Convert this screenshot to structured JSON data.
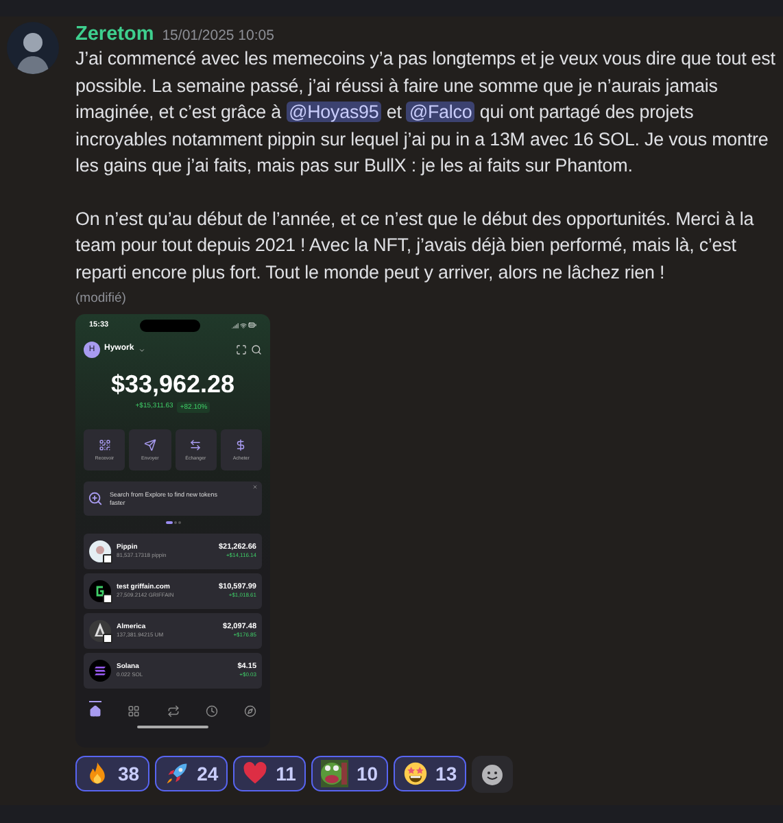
{
  "message": {
    "author": "Zeretom",
    "timestamp": "15/01/2025 10:05",
    "paragraphs": [
      [
        {
          "kind": "text",
          "text": "J’ai commencé avec les memecoins y’a pas longtemps et je veux vous dire que tout est possible. La semaine passé, j’ai réussi à faire une somme que je n’aurais jamais imaginée, et c’est grâce à "
        },
        {
          "kind": "mention",
          "text": "@Hoyas95"
        },
        {
          "kind": "text",
          "text": " et "
        },
        {
          "kind": "mention",
          "text": "@Falco"
        },
        {
          "kind": "text",
          "text": " qui ont partagé des projets incroyables notamment pippin sur lequel j’ai pu in a 13M avec 16 SOL. Je vous montre les gains que j’ai faits, mais pas sur BullX : je les ai faits sur Phantom."
        }
      ],
      [
        {
          "kind": "text",
          "text": "On n’est qu’au début de l’année, et ce n’est que le début des opportunités. Merci à la team pour tout depuis 2021 ! Avec la NFT, j’avais déjà bien performé, mais là, c’est reparti encore plus fort. Tout le monde peut y arriver, alors ne lâchez rien !"
        }
      ]
    ],
    "edited": "(modifié)"
  },
  "phone": {
    "status_time": "15:33",
    "account": {
      "initial": "H",
      "name": "Hywork"
    },
    "balance": "$33,962.28",
    "change": "+$15,311.63",
    "change_percent": "+82.10%",
    "actions": [
      {
        "kind": "receive",
        "label": "Recevoir"
      },
      {
        "kind": "send",
        "label": "Envoyer"
      },
      {
        "kind": "swap",
        "label": "Échanger"
      },
      {
        "kind": "buy",
        "label": "Acheter"
      }
    ],
    "banner": "Search from Explore to find new tokens faster",
    "carousel_dots": [
      {
        "selected": true
      },
      {
        "selected": false
      },
      {
        "selected": false
      }
    ],
    "tokens": [
      {
        "kind": "pippin",
        "name": "Pippin",
        "amount": "81,537.17318 pippin",
        "value": "$21,262.66",
        "gain": "+$14,116.14",
        "badge": true
      },
      {
        "kind": "griffain",
        "name": "test griffain.com",
        "amount": "27,509.2142 GRIFFAIN",
        "value": "$10,597.99",
        "gain": "+$1,018.61",
        "badge": true
      },
      {
        "kind": "almerica",
        "name": "Almerica",
        "amount": "137,381.94215 UM",
        "value": "$2,097.48",
        "gain": "+$176.85",
        "badge": true
      },
      {
        "kind": "solana",
        "name": "Solana",
        "amount": "0.022 SOL",
        "value": "$4.15",
        "gain": "+$0.03",
        "badge": false
      }
    ],
    "nav": [
      {
        "kind": "home",
        "selected": true
      },
      {
        "kind": "grid",
        "selected": false
      },
      {
        "kind": "swap",
        "selected": false
      },
      {
        "kind": "history",
        "selected": false
      },
      {
        "kind": "explore",
        "selected": false
      }
    ]
  },
  "reactions": [
    {
      "kind": "fire",
      "count": "38",
      "selected": true
    },
    {
      "kind": "rocket",
      "count": "24",
      "selected": true
    },
    {
      "kind": "heart",
      "count": "11",
      "selected": true
    },
    {
      "kind": "frog",
      "count": "10",
      "selected": true
    },
    {
      "kind": "star_eyes",
      "count": "13",
      "selected": true
    }
  ]
}
